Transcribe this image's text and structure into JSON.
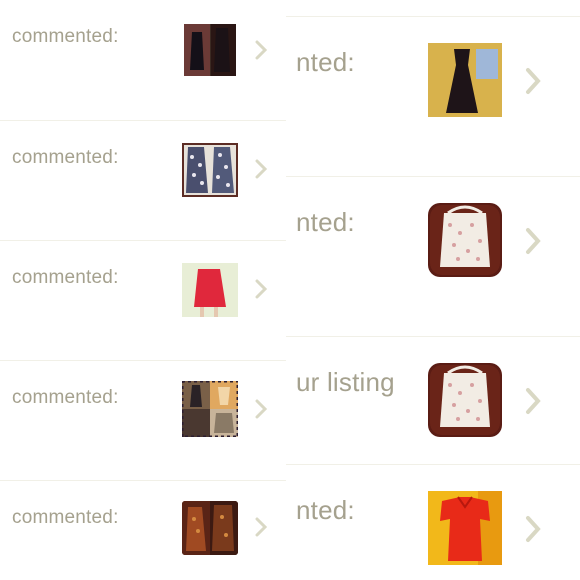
{
  "left_column": [
    {
      "text": "commented:",
      "thumb": "black-dress-thumbnail"
    },
    {
      "text": "commented:",
      "thumb": "printed-dresses-thumbnail"
    },
    {
      "text": "commented:",
      "thumb": "red-skirt-thumbnail"
    },
    {
      "text": "commented:",
      "thumb": "outfit-collage-thumbnail"
    },
    {
      "text": "commented:",
      "thumb": "dark-dress-thumbnail"
    }
  ],
  "right_column": [
    {
      "text": "nted:",
      "thumb": "black-dress-thumbnail"
    },
    {
      "text": "nted:",
      "thumb": "hm-bag-thumbnail"
    },
    {
      "text": "ur listing",
      "thumb": "hm-bag-thumbnail"
    },
    {
      "text": "nted:",
      "thumb": "red-top-thumbnail"
    }
  ],
  "icons": {
    "chevron": "chevron-right-icon"
  },
  "colors": {
    "text": "#a5a18e",
    "chevron": "#d9d8c4",
    "separator": "#f1f0e7"
  }
}
